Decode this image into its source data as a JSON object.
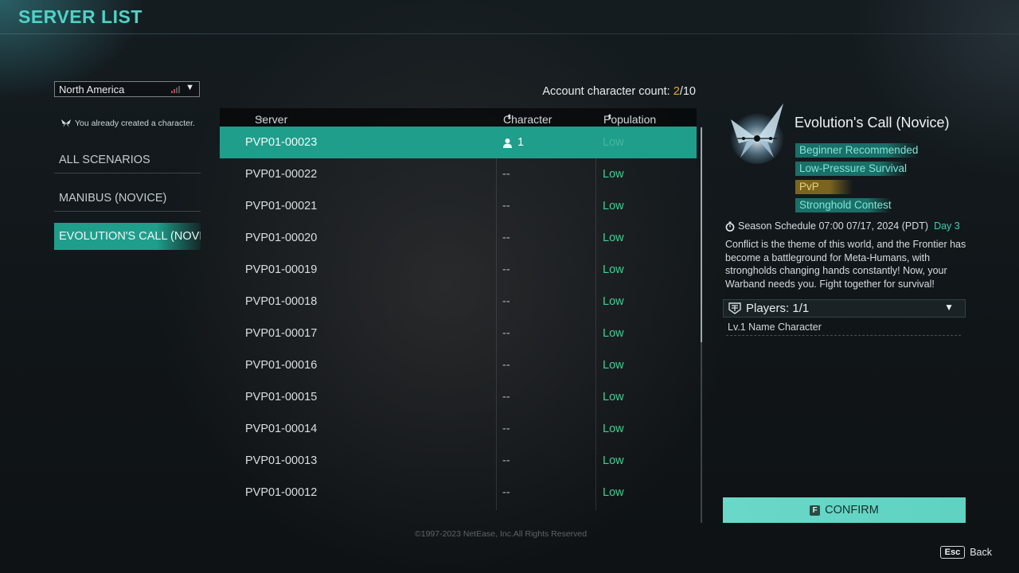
{
  "title": "SERVER LIST",
  "region": {
    "selected": "North America"
  },
  "notice": "You already created a character.",
  "scenarios": [
    {
      "label": "ALL SCENARIOS",
      "active": false
    },
    {
      "label": "MANIBUS (NOVICE)",
      "active": false
    },
    {
      "label": "EVOLUTION'S CALL (NOVI",
      "active": true
    }
  ],
  "account": {
    "label": "Account character count:",
    "current": "2",
    "separator": "/",
    "max": "10"
  },
  "table": {
    "headers": {
      "server": "Server",
      "character": "Character",
      "population": "Population"
    },
    "rows": [
      {
        "server": "PVP01-00023",
        "character": "1",
        "population": "Low",
        "selected": true
      },
      {
        "server": "PVP01-00022",
        "character": "--",
        "population": "Low"
      },
      {
        "server": "PVP01-00021",
        "character": "--",
        "population": "Low"
      },
      {
        "server": "PVP01-00020",
        "character": "--",
        "population": "Low"
      },
      {
        "server": "PVP01-00019",
        "character": "--",
        "population": "Low"
      },
      {
        "server": "PVP01-00018",
        "character": "--",
        "population": "Low"
      },
      {
        "server": "PVP01-00017",
        "character": "--",
        "population": "Low"
      },
      {
        "server": "PVP01-00016",
        "character": "--",
        "population": "Low"
      },
      {
        "server": "PVP01-00015",
        "character": "--",
        "population": "Low"
      },
      {
        "server": "PVP01-00014",
        "character": "--",
        "population": "Low"
      },
      {
        "server": "PVP01-00013",
        "character": "--",
        "population": "Low"
      },
      {
        "server": "PVP01-00012",
        "character": "--",
        "population": "Low"
      }
    ]
  },
  "detail": {
    "title": "Evolution's Call (Novice)",
    "tags": [
      {
        "label": "Beginner Recommended",
        "style": "teal"
      },
      {
        "label": "Low-Pressure Survival",
        "style": "teal"
      },
      {
        "label": "PvP",
        "style": "gold"
      },
      {
        "label": "Stronghold Contest",
        "style": "teal"
      }
    ],
    "season": {
      "label": "Season Schedule 07:00 07/17, 2024 (PDT)",
      "day": "Day 3"
    },
    "description": "Conflict is the theme of this world, and the Frontier has become a battleground for Meta-Humans, with strongholds changing hands constantly! Now, your Warband needs you. Fight together for survival!",
    "players": {
      "label": "Players: 1/1",
      "header": "Lv.1 Name Character"
    }
  },
  "confirm": {
    "key": "F",
    "label": "CONFIRM"
  },
  "copyright": "©1997-2023 NetEase, Inc.All Rights Reserved",
  "back": {
    "key": "Esc",
    "label": "Back"
  },
  "colors": {
    "accent": "#1f9e8c",
    "population_low": "#3fcf95",
    "highlight": "#e7a93a",
    "confirm": "#6ad8c8"
  },
  "icons": {
    "region_signal": "signal-bars-icon",
    "notice": "butterfly-icon",
    "character": "person-icon",
    "season": "stopwatch-icon",
    "players": "warband-icon"
  }
}
